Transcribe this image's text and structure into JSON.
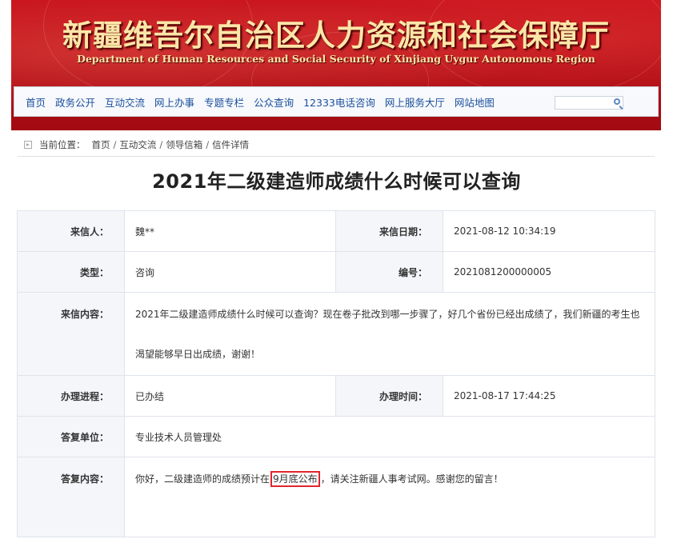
{
  "header": {
    "title_cn": "新疆维吾尔自治区人力资源和社会保障厅",
    "title_en": "Department of Human Resources and Social Security of Xinjiang Uygur Autonomous Region",
    "nav": [
      "首页",
      "政务公开",
      "互动交流",
      "网上办事",
      "专题专栏",
      "公众查询",
      "12333电话咨询",
      "网上服务大厅",
      "网站地图"
    ],
    "search_value": "",
    "colors": {
      "banner_red": "#c8121c",
      "title_gold": "#fbe6a8",
      "nav_link": "#1b4f9c"
    }
  },
  "breadcrumb": {
    "prefix": "当前位置：",
    "items": [
      "首页",
      "互动交流",
      "领导信箱",
      "信件详情"
    ],
    "separator": "/"
  },
  "page_title": "2021年二级建造师成绩什么时候可以查询",
  "detail": {
    "sender_label": "来信人：",
    "sender_value": "魏**",
    "date_label": "来信日期：",
    "date_value": "2021-08-12 10:34:19",
    "type_label": "类型：",
    "type_value": "咨询",
    "number_label": "编号：",
    "number_value": "2021081200000005",
    "content_label": "来信内容：",
    "content_value": "2021年二级建造师成绩什么时候可以查询？现在卷子批改到哪一步骤了，好几个省份已经出成绩了，我们新疆的考生也渴望能够早日出成绩，谢谢！",
    "progress_label": "办理进程：",
    "progress_value": "已办结",
    "handle_time_label": "办理时间：",
    "handle_time_value": "2021-08-17 17:44:25",
    "reply_unit_label": "答复单位：",
    "reply_unit_value": "专业技术人员管理处",
    "reply_label": "答复内容：",
    "reply_before": "你好，二级建造师的成绩预计在",
    "reply_highlight": "9月底公布",
    "reply_after": "，请关注新疆人事考试网。感谢您的留言！",
    "highlight_color": "#e0262b"
  }
}
